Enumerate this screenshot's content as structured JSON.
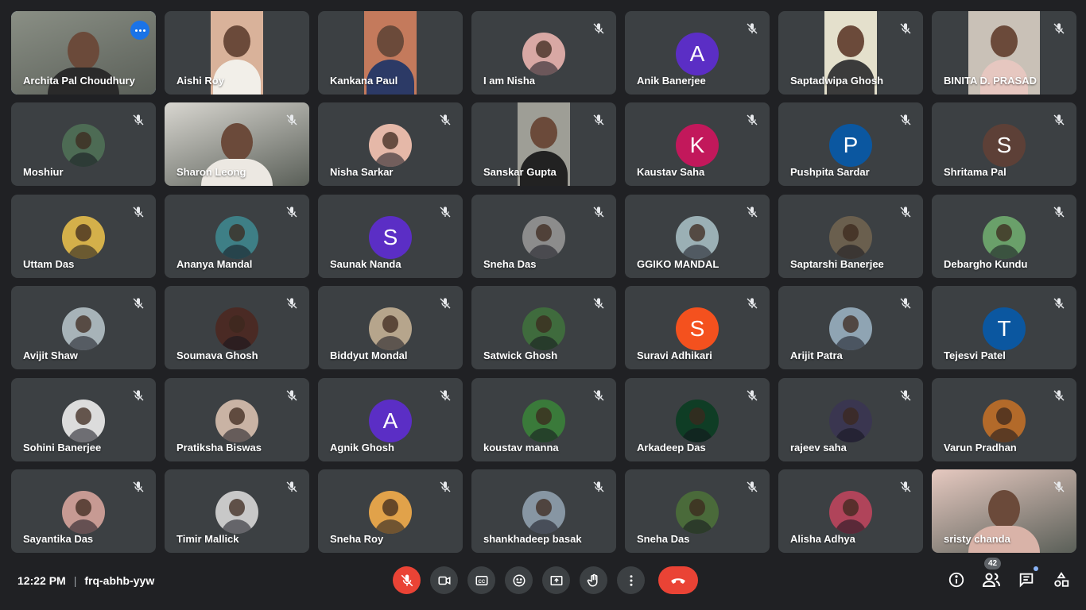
{
  "meeting": {
    "time": "12:22 PM",
    "separator": "|",
    "code": "frq-abhb-yyw"
  },
  "participants_count": "42",
  "colors": {
    "background": "#202124",
    "tile": "#3c4043",
    "end_call": "#ea4335",
    "accent": "#1a73e8"
  },
  "tiles": [
    {
      "name": "Archita Pal Choudhury",
      "kind": "video",
      "video_style": "strip-full",
      "bg": "#8a8f85",
      "active": true,
      "more": true
    },
    {
      "name": "Aishi Roy",
      "kind": "video",
      "bg": "#d9b29a",
      "body": "#f2efe9"
    },
    {
      "name": "Kankana Paul",
      "kind": "video",
      "bg": "#c47a5c",
      "body": "#2c3a66"
    },
    {
      "name": "I am Nisha",
      "kind": "photo",
      "bg": "#d8a8a4",
      "muted": true
    },
    {
      "name": "Anik Banerjee",
      "kind": "letter",
      "letter": "A",
      "bg": "#5b2ec5",
      "muted": true
    },
    {
      "name": "Saptadwipa Ghosh",
      "kind": "video",
      "bg": "#e4e0cc",
      "body": "#3b3b3b",
      "muted": true
    },
    {
      "name": "BINITA D. PRASAD",
      "kind": "video",
      "video_style": "wide",
      "bg": "#c9c1b7",
      "body": "#e6c7c0",
      "muted": true
    },
    {
      "name": "Moshiur",
      "kind": "photo",
      "bg": "#4d6b54",
      "muted": true
    },
    {
      "name": "Sharon Leong",
      "kind": "video",
      "video_style": "full",
      "bg": "#d8d6d0",
      "body": "#ece8e2",
      "muted": true
    },
    {
      "name": "Nisha Sarkar",
      "kind": "photo",
      "bg": "#e5b8a8",
      "muted": true
    },
    {
      "name": "Sanskar Gupta",
      "kind": "video",
      "bg": "#9e9e96",
      "body": "#222222",
      "muted": true
    },
    {
      "name": "Kaustav Saha",
      "kind": "letter",
      "letter": "K",
      "bg": "#c2185b",
      "muted": true
    },
    {
      "name": "Pushpita Sardar",
      "kind": "letter",
      "letter": "P",
      "bg": "#0b57a0",
      "muted": true
    },
    {
      "name": "Shritama Pal",
      "kind": "letter",
      "letter": "S",
      "bg": "#5d4037",
      "muted": true
    },
    {
      "name": "Uttam Das",
      "kind": "photo",
      "bg": "#d4b04a",
      "muted": true
    },
    {
      "name": "Ananya Mandal",
      "kind": "photo",
      "bg": "#3e7f86",
      "muted": true
    },
    {
      "name": "Saunak Nanda",
      "kind": "letter",
      "letter": "S",
      "bg": "#5b2ec5",
      "muted": true
    },
    {
      "name": "Sneha Das",
      "kind": "photo",
      "bg": "#8c8c8c",
      "muted": true
    },
    {
      "name": "GGIKO MANDAL",
      "kind": "photo",
      "bg": "#9bb0b5",
      "muted": true
    },
    {
      "name": "Saptarshi Banerjee",
      "kind": "photo",
      "bg": "#6a5f4e",
      "muted": true
    },
    {
      "name": "Debargho Kundu",
      "kind": "photo",
      "bg": "#6aa06a",
      "muted": true
    },
    {
      "name": "Avijit Shaw",
      "kind": "photo",
      "bg": "#a7b3b8",
      "muted": true
    },
    {
      "name": "Soumava Ghosh",
      "kind": "photo",
      "bg": "#4a2a24",
      "muted": true
    },
    {
      "name": "Biddyut Mondal",
      "kind": "photo",
      "bg": "#b6a58c",
      "muted": true
    },
    {
      "name": "Satwick Ghosh",
      "kind": "photo",
      "bg": "#3f6b3d",
      "muted": true
    },
    {
      "name": "Suravi Adhikari",
      "kind": "letter",
      "letter": "S",
      "bg": "#f4511e",
      "muted": true
    },
    {
      "name": "Arijit Patra",
      "kind": "photo",
      "bg": "#8fa4b3",
      "muted": true
    },
    {
      "name": "Tejesvi Patel",
      "kind": "letter",
      "letter": "T",
      "bg": "#0b57a0",
      "muted": true
    },
    {
      "name": "Sohini Banerjee",
      "kind": "photo",
      "bg": "#dcdcdc",
      "muted": true
    },
    {
      "name": "Pratiksha Biswas",
      "kind": "photo",
      "bg": "#c9b3a4",
      "muted": true
    },
    {
      "name": "Agnik Ghosh",
      "kind": "letter",
      "letter": "A",
      "bg": "#5b2ec5",
      "muted": true
    },
    {
      "name": "koustav manna",
      "kind": "photo",
      "bg": "#3a7a3a",
      "muted": true
    },
    {
      "name": "Arkadeep Das",
      "kind": "photo",
      "bg": "#0f3d25",
      "muted": true
    },
    {
      "name": "rajeev saha",
      "kind": "photo",
      "bg": "#3a3650",
      "muted": true
    },
    {
      "name": "Varun Pradhan",
      "kind": "photo",
      "bg": "#b36a2a",
      "muted": true
    },
    {
      "name": "Sayantika Das",
      "kind": "photo",
      "bg": "#c79a93",
      "muted": true
    },
    {
      "name": "Timir Mallick",
      "kind": "photo",
      "bg": "#c8c8c8",
      "muted": true
    },
    {
      "name": "Sneha Roy",
      "kind": "photo",
      "bg": "#e1a24a",
      "muted": true
    },
    {
      "name": "shankhadeep basak",
      "kind": "photo",
      "bg": "#8796a3",
      "muted": true
    },
    {
      "name": "Sneha Das",
      "kind": "photo",
      "bg": "#4a6a3a",
      "muted": true
    },
    {
      "name": "Alisha Adhya",
      "kind": "photo",
      "bg": "#b0445a",
      "muted": true
    },
    {
      "name": "sristy chanda",
      "kind": "video",
      "video_style": "full",
      "bg": "#e6c9c0",
      "body": "#d9b3a8",
      "muted": true
    }
  ]
}
